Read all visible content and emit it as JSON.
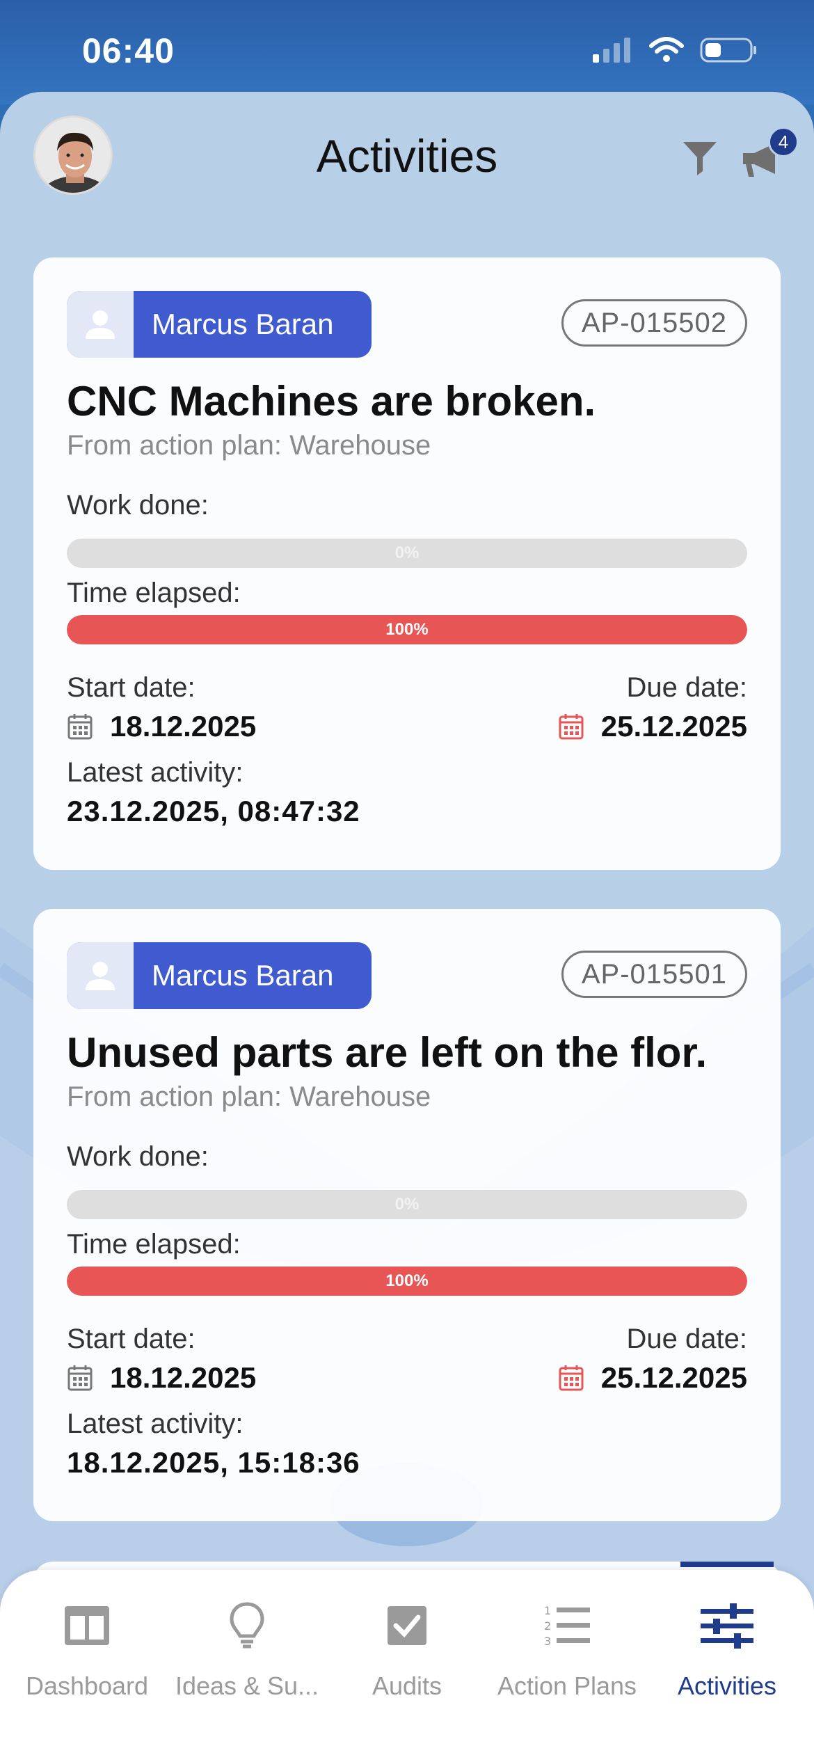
{
  "status_bar": {
    "time": "06:40"
  },
  "header": {
    "title": "Activities",
    "notification_count": "4"
  },
  "cards": [
    {
      "assignee": "Marcus Baran",
      "code": "AP-015502",
      "title": "CNC Machines are broken.",
      "subtitle": "From action plan: Warehouse",
      "work_done_label": "Work done:",
      "work_done_value": 0,
      "work_done_text": "0%",
      "time_elapsed_label": "Time elapsed:",
      "time_elapsed_value": 100,
      "time_elapsed_text": "100%",
      "start_label": "Start date:",
      "start_date": "18.12.2025",
      "due_label": "Due date:",
      "due_date": "25.12.2025",
      "latest_label": "Latest activity:",
      "latest_value": "23.12.2025, 08:47:32"
    },
    {
      "assignee": "Marcus Baran",
      "code": "AP-015501",
      "title": "Unused parts are left on the flor.",
      "subtitle": "From action plan: Warehouse",
      "work_done_label": "Work done:",
      "work_done_value": 0,
      "work_done_text": "0%",
      "time_elapsed_label": "Time elapsed:",
      "time_elapsed_value": 100,
      "time_elapsed_text": "100%",
      "start_label": "Start date:",
      "start_date": "18.12.2025",
      "due_label": "Due date:",
      "due_date": "25.12.2025",
      "latest_label": "Latest activity:",
      "latest_value": "18.12.2025, 15:18:36"
    }
  ],
  "tabs": [
    {
      "label": "Dashboard",
      "icon": "dashboard-icon",
      "active": false
    },
    {
      "label": "Ideas & Su...",
      "icon": "lightbulb-icon",
      "active": false
    },
    {
      "label": "Audits",
      "icon": "checkbox-icon",
      "active": false
    },
    {
      "label": "Action Plans",
      "icon": "numbered-list-icon",
      "active": false
    },
    {
      "label": "Activities",
      "icon": "sliders-icon",
      "active": true
    }
  ],
  "colors": {
    "accent": "#1f3b8c",
    "assignee_bg": "#3f5bcf",
    "danger": "#e85555",
    "track": "#dedede",
    "inactive": "#9a9a9a"
  }
}
